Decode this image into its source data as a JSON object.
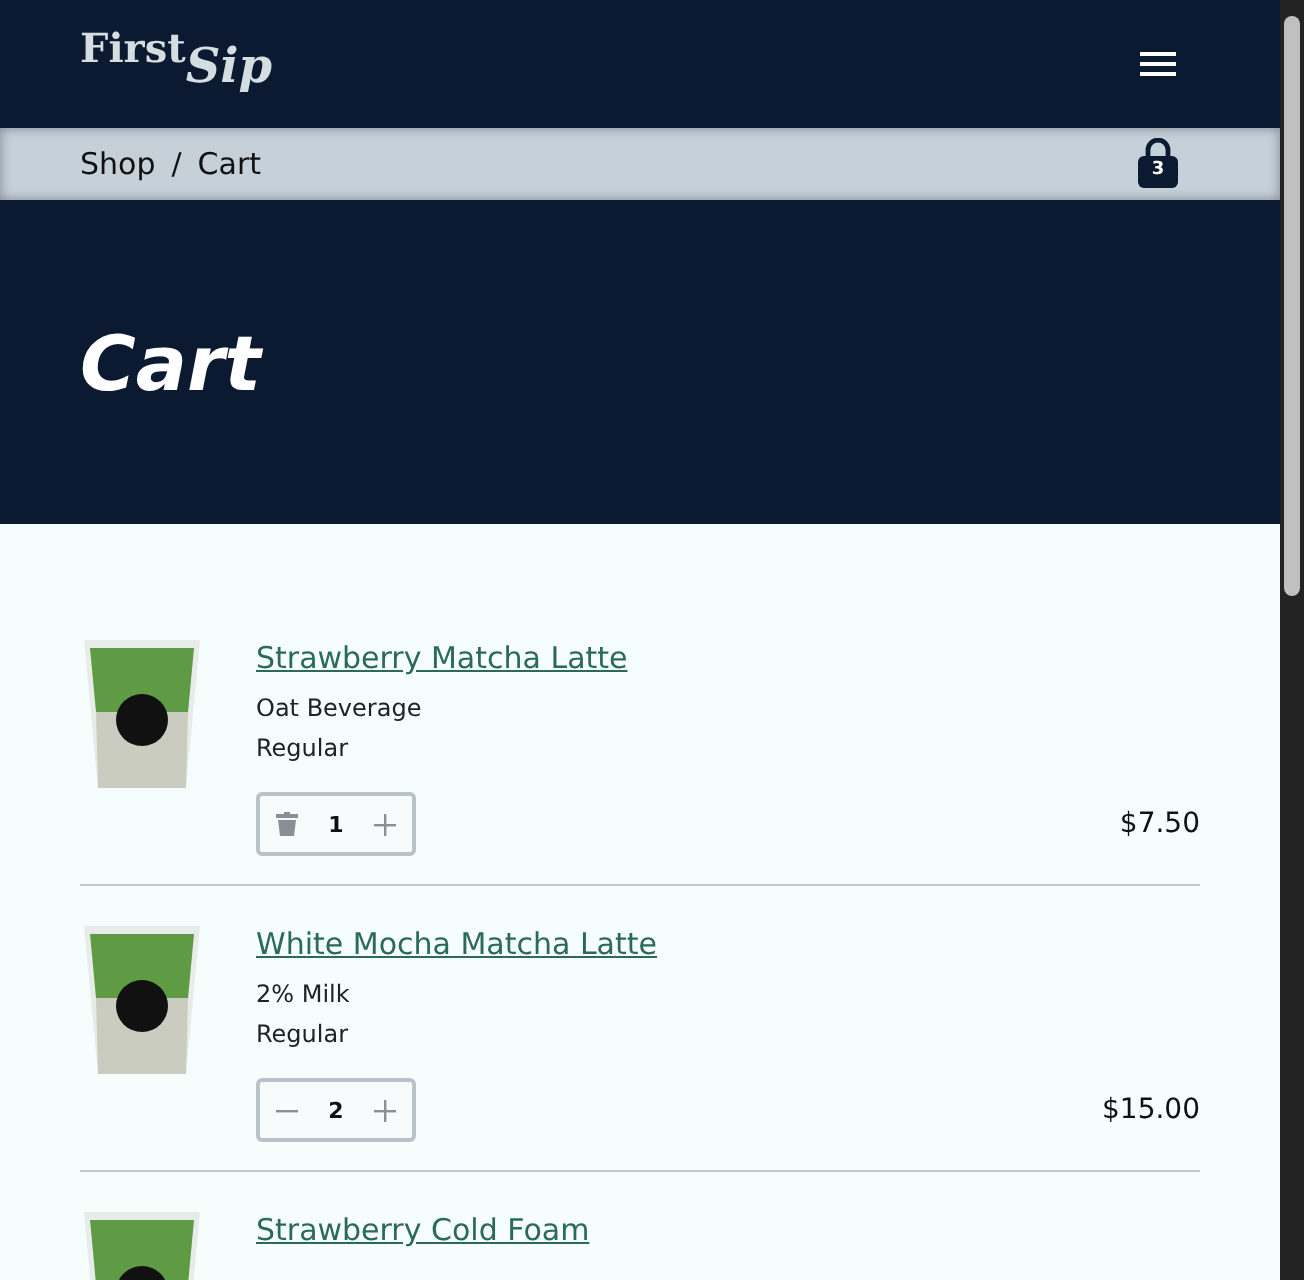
{
  "header": {
    "logo_first": "First",
    "logo_second": "Sip"
  },
  "breadcrumb": {
    "items": [
      "Shop",
      "Cart"
    ],
    "separator": "/",
    "cart_count": "3"
  },
  "page_title": "Cart",
  "cart_items": [
    {
      "name": "Strawberry Matcha Latte",
      "options": [
        "Oat Beverage",
        "Regular"
      ],
      "quantity": "1",
      "kind": "trash",
      "price": "$7.50"
    },
    {
      "name": "White Mocha Matcha Latte",
      "options": [
        "2% Milk",
        "Regular"
      ],
      "quantity": "2",
      "kind": "minus",
      "price": "$15.00"
    },
    {
      "name": "Strawberry Cold Foam"
    }
  ]
}
